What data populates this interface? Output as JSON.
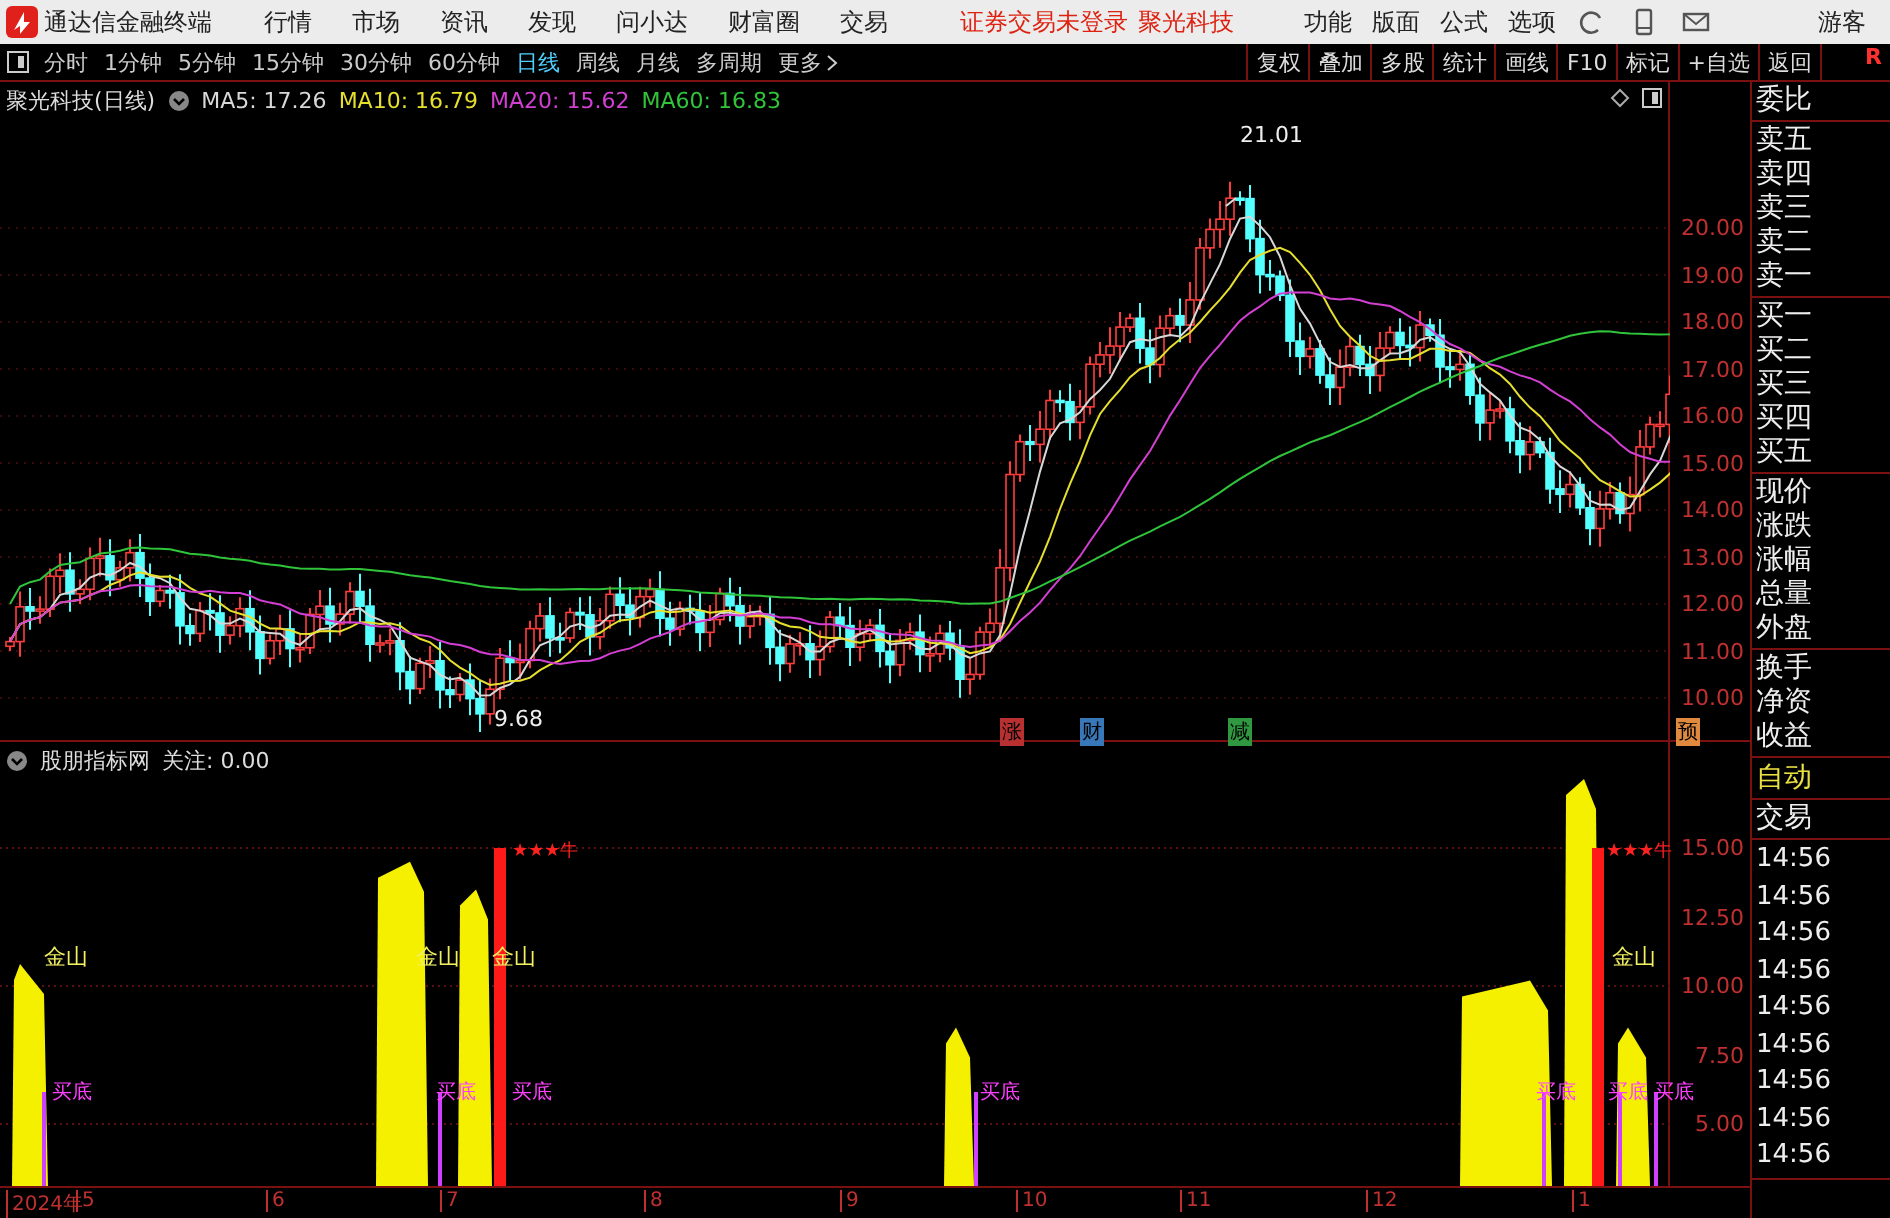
{
  "menubar": {
    "app_title": "通达信金融终端",
    "menus": [
      "行情",
      "市场",
      "资讯",
      "发现",
      "问小达",
      "财富圈",
      "交易"
    ],
    "notice": "证券交易未登录",
    "stock": "聚光科技",
    "tools": [
      "功能",
      "版面",
      "公式",
      "选项"
    ],
    "user": "游客"
  },
  "toolbar": {
    "periods": [
      {
        "label": "分时",
        "selected": false
      },
      {
        "label": "1分钟",
        "selected": false
      },
      {
        "label": "5分钟",
        "selected": false
      },
      {
        "label": "15分钟",
        "selected": false
      },
      {
        "label": "30分钟",
        "selected": false
      },
      {
        "label": "60分钟",
        "selected": false
      },
      {
        "label": "日线",
        "selected": true
      },
      {
        "label": "周线",
        "selected": false
      },
      {
        "label": "月线",
        "selected": false
      },
      {
        "label": "多周期",
        "selected": false
      },
      {
        "label": "更多",
        "selected": false
      }
    ],
    "actions": [
      "复权",
      "叠加",
      "多股",
      "统计",
      "画线",
      "F10",
      "标记",
      "+自选",
      "返回"
    ],
    "flag": "R"
  },
  "main_chart": {
    "title": "聚光科技(日线)",
    "ma": [
      {
        "label": "MA5: 17.26",
        "color": "#d8d8d8"
      },
      {
        "label": "MA10: 16.79",
        "color": "#e6df2e"
      },
      {
        "label": "MA20: 15.62",
        "color": "#d23fd2"
      },
      {
        "label": "MA60: 16.83",
        "color": "#2fc43a"
      }
    ],
    "yticks": [
      "20.00",
      "19.00",
      "18.00",
      "17.00",
      "16.00",
      "15.00",
      "14.00",
      "13.00",
      "12.00",
      "11.00",
      "10.00"
    ],
    "high_label": "21.01",
    "low_label": "9.68",
    "markers": [
      {
        "text": "涨",
        "color": "#b83030"
      },
      {
        "text": "财",
        "color": "#3878b8"
      },
      {
        "text": "减",
        "color": "#309840"
      },
      {
        "text": "预",
        "color": "#e08a40"
      }
    ]
  },
  "indicator": {
    "title": "股朋指标网",
    "focus": "关注: 0.00",
    "yticks": [
      "15.00",
      "12.50",
      "10.00",
      "7.50",
      "5.00"
    ],
    "gold_labels": [
      "金山",
      "金山",
      "金山",
      "金山"
    ],
    "buy_labels": [
      "买底",
      "买底",
      "买底",
      "买底",
      "买底",
      "买底",
      "买底"
    ],
    "signals": [
      "★★★牛",
      "★★★牛"
    ]
  },
  "x_axis": [
    "2024年",
    "5",
    "6",
    "7",
    "8",
    "9",
    "10",
    "11",
    "12",
    "1"
  ],
  "sidebar": {
    "groups": [
      [
        "委比"
      ],
      [
        "卖五",
        "卖四",
        "卖三",
        "卖二",
        "卖一"
      ],
      [
        "买一",
        "买二",
        "买三",
        "买四",
        "买五"
      ],
      [
        "现价",
        "涨跌",
        "涨幅",
        "总量",
        "外盘"
      ],
      [
        "换手",
        "净资",
        "收益"
      ]
    ],
    "mode": "自动",
    "trade_title": "交易",
    "times": [
      "14:56",
      "14:56",
      "14:56",
      "14:56",
      "14:56",
      "14:56",
      "14:56",
      "14:56",
      "14:56"
    ]
  }
}
